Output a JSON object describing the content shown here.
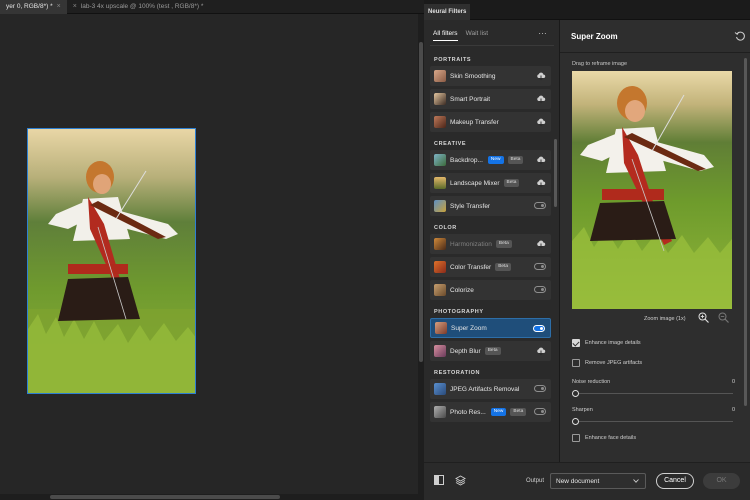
{
  "document_tabs": [
    {
      "label": "yer 0, RGB/8*) *",
      "active": true
    },
    {
      "label": "lab-3 4x upscale @ 100% (test , RGB/8*) *",
      "active": false
    }
  ],
  "panel": {
    "title": "Neural Filters",
    "tabs": [
      "All filters",
      "Wait list"
    ],
    "more": "…"
  },
  "categories": {
    "portraits": "PORTRAITS",
    "creative": "CREATIVE",
    "color": "COLOR",
    "photography": "PHOTOGRAPHY",
    "restoration": "RESTORATION"
  },
  "filters": [
    {
      "label": "Skin Smoothing",
      "control": "cloud"
    },
    {
      "label": "Smart Portrait",
      "control": "cloud"
    },
    {
      "label": "Makeup Transfer",
      "control": "cloud"
    },
    {
      "label": "Backdrop...",
      "new": "New",
      "beta": "Beta",
      "control": "cloud"
    },
    {
      "label": "Landscape Mixer",
      "beta": "Beta",
      "control": "cloud"
    },
    {
      "label": "Style Transfer",
      "control": "toggle"
    },
    {
      "label": "Harmonization",
      "beta": "Beta",
      "control": "cloud",
      "disabled": true
    },
    {
      "label": "Color Transfer",
      "beta": "Beta",
      "control": "toggle"
    },
    {
      "label": "Colorize",
      "control": "toggle"
    },
    {
      "label": "Super Zoom",
      "control": "toggle-on",
      "selected": true
    },
    {
      "label": "Depth Blur",
      "beta": "Beta",
      "control": "cloud"
    },
    {
      "label": "JPEG Artifacts Removal",
      "control": "toggle"
    },
    {
      "label": "Photo Res...",
      "new": "New",
      "beta": "Beta",
      "control": "toggle"
    }
  ],
  "settings": {
    "title": "Super Zoom",
    "drag_hint": "Drag to reframe image",
    "zoom_label": "Zoom image (1x)",
    "enhance_details": "Enhance image details",
    "remove_jpeg": "Remove JPEG artifacts",
    "noise_label": "Noise reduction",
    "noise_value": "0",
    "sharpen_label": "Sharpen",
    "sharpen_value": "0",
    "enhance_face": "Enhance face details"
  },
  "footer": {
    "output_label": "Output",
    "output_value": "New document",
    "cancel": "Cancel",
    "ok": "OK"
  },
  "colors": {
    "accent": "#1473e6",
    "selection": "#1f4e7a",
    "panel": "#2a2a2a"
  }
}
